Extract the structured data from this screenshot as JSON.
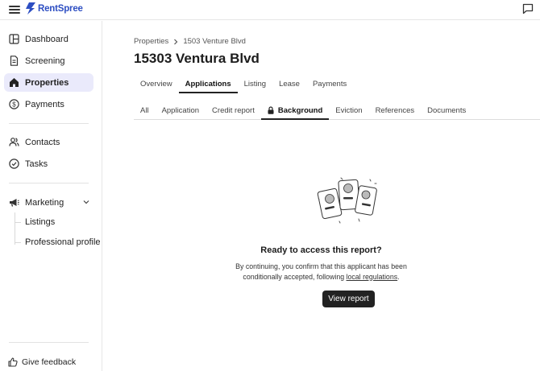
{
  "app": {
    "brand": "RentSpree",
    "brand_color": "#2d4ec2"
  },
  "sidebar": {
    "items": [
      {
        "label": "Dashboard",
        "icon": "dashboard-icon"
      },
      {
        "label": "Screening",
        "icon": "document-icon"
      },
      {
        "label": "Properties",
        "icon": "home-icon",
        "active": true
      },
      {
        "label": "Payments",
        "icon": "dollar-icon"
      },
      {
        "label": "Contacts",
        "icon": "users-icon"
      },
      {
        "label": "Tasks",
        "icon": "check-circle-icon"
      },
      {
        "label": "Marketing",
        "icon": "megaphone-icon",
        "expanded": true
      }
    ],
    "marketing_sub": [
      "Listings",
      "Professional profile"
    ],
    "feedback_label": "Give feedback"
  },
  "breadcrumb": {
    "parent": "Properties",
    "current": "1503 Venture Blvd"
  },
  "page_title": "15303 Ventura Blvd",
  "tabs": [
    {
      "label": "Overview"
    },
    {
      "label": "Applications",
      "active": true
    },
    {
      "label": "Listing"
    },
    {
      "label": "Lease"
    },
    {
      "label": "Payments"
    }
  ],
  "subtabs": [
    {
      "label": "All"
    },
    {
      "label": "Application"
    },
    {
      "label": "Credit report"
    },
    {
      "label": "Background",
      "active": true,
      "locked": true
    },
    {
      "label": "Eviction"
    },
    {
      "label": "References"
    },
    {
      "label": "Documents"
    }
  ],
  "empty_state": {
    "title": "Ready to access this report?",
    "body_line1": "By continuing, you confirm that this applicant has been",
    "body_line2_prefix": "conditionally accepted, following ",
    "body_link": "local regulations",
    "body_line2_suffix": ".",
    "button": "View report"
  }
}
